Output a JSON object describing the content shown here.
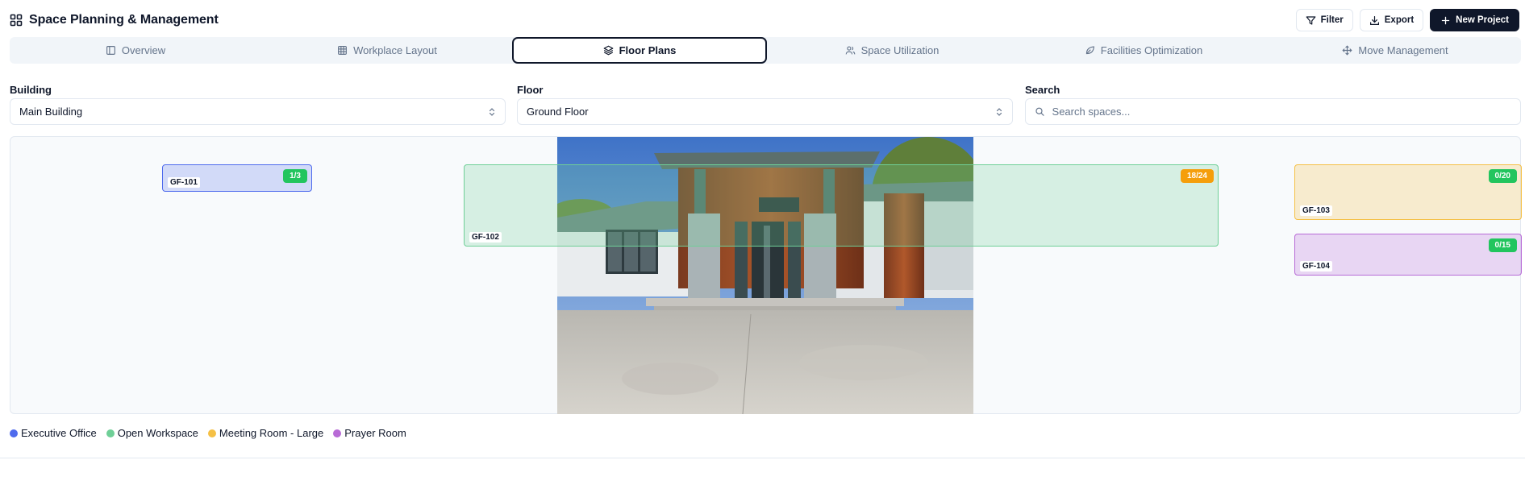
{
  "app": {
    "title": "Space Planning & Management"
  },
  "header": {
    "filter_label": "Filter",
    "export_label": "Export",
    "new_project_label": "New Project"
  },
  "tabs": [
    {
      "label": "Overview",
      "icon": "panel-icon",
      "active": false
    },
    {
      "label": "Workplace Layout",
      "icon": "grid-icon",
      "active": false
    },
    {
      "label": "Floor Plans",
      "icon": "layers-icon",
      "active": true
    },
    {
      "label": "Space Utilization",
      "icon": "users-icon",
      "active": false
    },
    {
      "label": "Facilities Optimization",
      "icon": "leaf-icon",
      "active": false
    },
    {
      "label": "Move Management",
      "icon": "move-icon",
      "active": false
    }
  ],
  "filters": {
    "building": {
      "label": "Building",
      "value": "Main Building"
    },
    "floor": {
      "label": "Floor",
      "value": "Ground Floor"
    },
    "search": {
      "label": "Search",
      "placeholder": "Search spaces..."
    }
  },
  "floor_plan": {
    "background": "house-exterior-photo",
    "rooms": [
      {
        "id": "GF-101",
        "occupancy": "1/3",
        "type": "Executive Office",
        "badge_color": "#22c55e"
      },
      {
        "id": "GF-102",
        "occupancy": "18/24",
        "type": "Open Workspace",
        "badge_color": "#f59e0b"
      },
      {
        "id": "GF-103",
        "occupancy": "0/20",
        "type": "Meeting Room - Large",
        "badge_color": "#22c55e"
      },
      {
        "id": "GF-104",
        "occupancy": "0/15",
        "type": "Prayer Room",
        "badge_color": "#22c55e"
      }
    ]
  },
  "legend": [
    {
      "label": "Executive Office",
      "color": "#4f6bed"
    },
    {
      "label": "Open Workspace",
      "color": "#6fcf97"
    },
    {
      "label": "Meeting Room - Large",
      "color": "#f5c045"
    },
    {
      "label": "Prayer Room",
      "color": "#b86bd6"
    }
  ]
}
